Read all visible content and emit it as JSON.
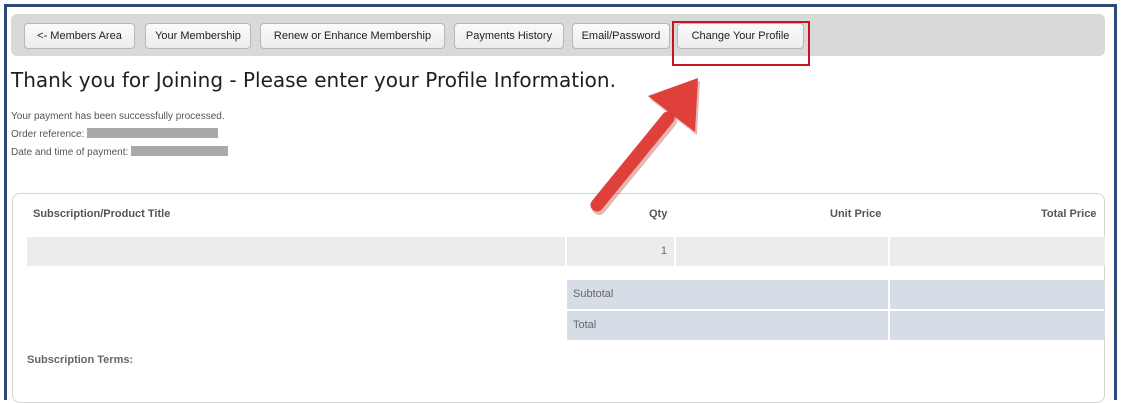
{
  "nav": {
    "items": [
      {
        "label": "<- Members Area"
      },
      {
        "label": "Your Membership"
      },
      {
        "label": "Renew or Enhance Membership"
      },
      {
        "label": "Payments History"
      },
      {
        "label": "Email/Password"
      },
      {
        "label": "Change Your Profile"
      }
    ]
  },
  "header": {
    "title": "Thank you for Joining - Please enter your Profile Information."
  },
  "payment": {
    "status": "Your payment has been successfully processed.",
    "order_reference_label": "Order reference:",
    "date_label": "Date and time of payment:"
  },
  "table": {
    "columns": [
      "Subscription/Product Title",
      "Qty",
      "Unit Price",
      "Total Price"
    ],
    "rows": [
      {
        "title": "",
        "qty": "1",
        "unit_price": "",
        "total_price": ""
      }
    ],
    "subtotal_label": "Subtotal",
    "total_label": "Total",
    "terms_label": "Subscription Terms:"
  },
  "colors": {
    "frame": "#2d4a77",
    "highlight": "#c4161c",
    "arrow": "#e0403a"
  },
  "annotations": {
    "arrow_icon": "arrow-pointer-icon"
  }
}
